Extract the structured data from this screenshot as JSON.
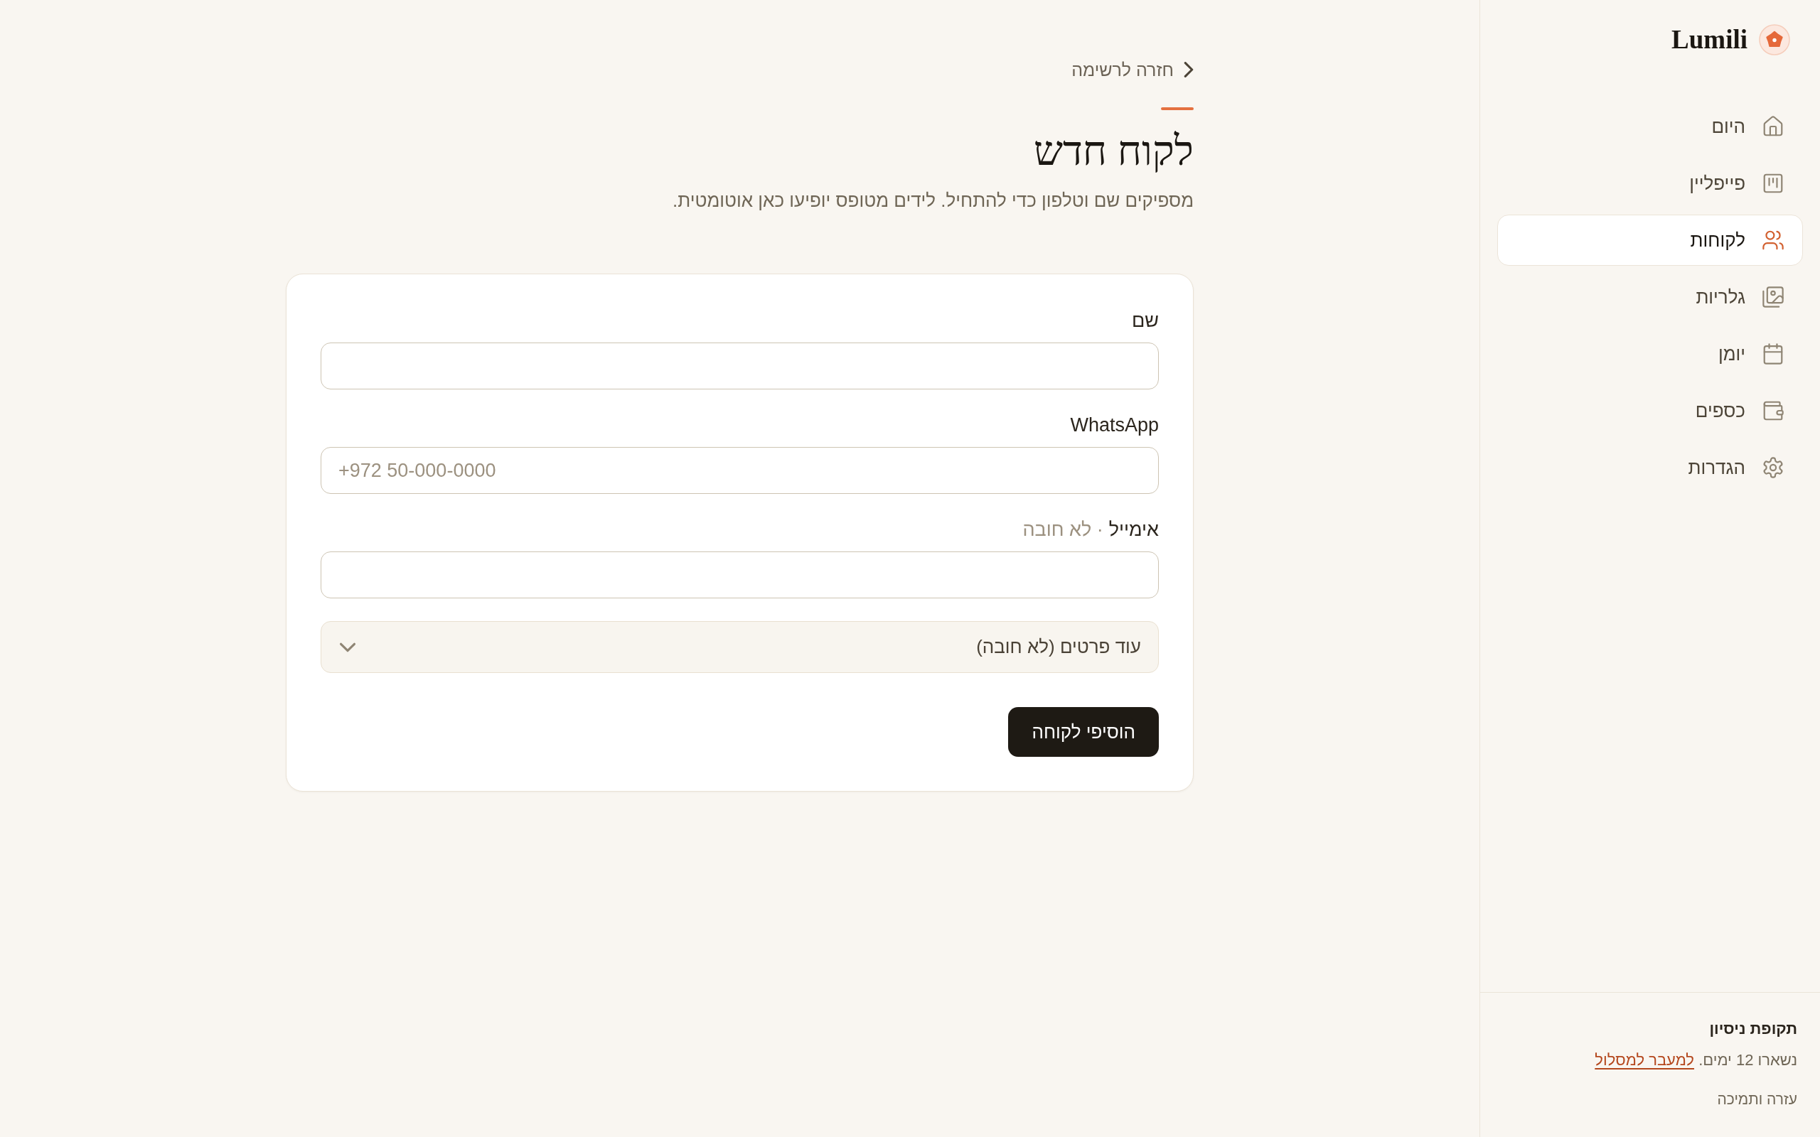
{
  "sidebar": {
    "brand": "Lumili",
    "nav": [
      {
        "label": "היום",
        "selected": false
      },
      {
        "label": "פייפליין",
        "selected": false
      },
      {
        "label": "לקוחות",
        "selected": true
      },
      {
        "label": "גלריות",
        "selected": false
      },
      {
        "label": "יומן",
        "selected": false
      },
      {
        "label": "כספים",
        "selected": false
      },
      {
        "label": "הגדרות",
        "selected": false
      }
    ],
    "trial": {
      "title": "תקופת ניסיון",
      "message": "נשארו 12 ימים.",
      "link": "למעבר למסלול"
    },
    "help_link": "עזרה ותמיכה"
  },
  "main": {
    "back_link": "חזרה לרשימה",
    "title": "לקוח חדש",
    "subtitle": "מספיקים שם וטלפון כדי להתחיל. לידים מטופס יופיעו כאן אוטומטית.",
    "form": {
      "fields": [
        {
          "label": "שם"
        },
        {
          "label": "WhatsApp",
          "placeholder": "+972 50-000-0000"
        },
        {
          "label": "אימייל",
          "note": "· לא חובה"
        }
      ],
      "more_details": {
        "label": "עוד פרטים (לא חובה)",
        "expanded": false
      },
      "submit": "הוסיפי לקוחה"
    }
  }
}
